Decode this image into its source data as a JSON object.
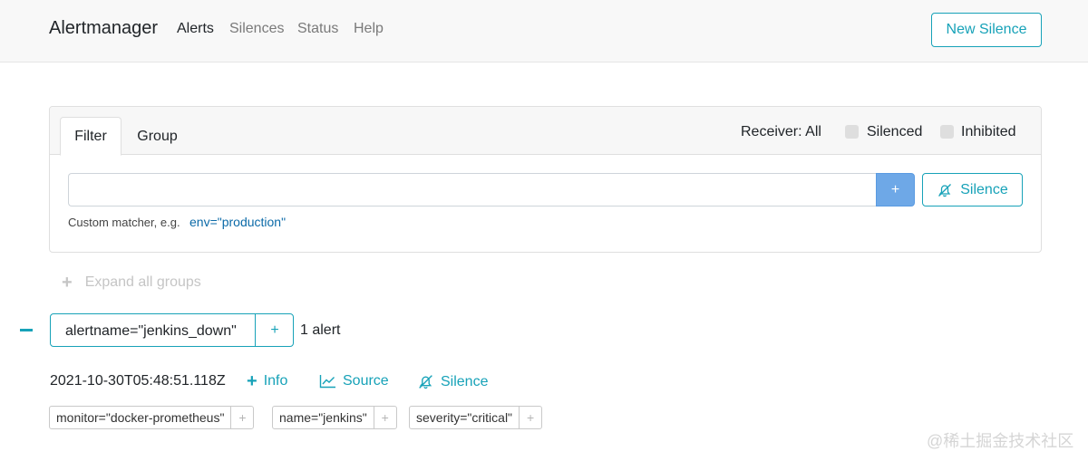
{
  "navbar": {
    "brand": "Alertmanager",
    "links": [
      "Alerts",
      "Silences",
      "Status",
      "Help"
    ],
    "new_silence_label": "New Silence"
  },
  "filter_card": {
    "tabs": [
      "Filter",
      "Group"
    ],
    "receiver_label": "Receiver: All",
    "silenced_label": "Silenced",
    "silenced_checked": false,
    "inhibited_label": "Inhibited",
    "inhibited_checked": false,
    "input_value": "",
    "add_button_label": "+",
    "silence_button_label": "Silence",
    "hint_text": "Custom matcher, e.g.",
    "hint_example": "env=\"production\""
  },
  "expand_all_label": "Expand all groups",
  "group": {
    "label": "alertname=\"jenkins_down\"",
    "add_label": "+",
    "count_text": "1 alert"
  },
  "alert": {
    "timestamp": "2021-10-30T05:48:51.118Z",
    "info_label": "Info",
    "source_label": "Source",
    "silence_label": "Silence",
    "labels": [
      "monitor=\"docker-prometheus\"",
      "name=\"jenkins\"",
      "severity=\"critical\""
    ],
    "label_add": "+"
  },
  "watermark": "@稀土掘金技术社区",
  "colors": {
    "accent": "#17a2b8",
    "primary_button": "#6ea8e7",
    "link": "#0b6aa8"
  }
}
